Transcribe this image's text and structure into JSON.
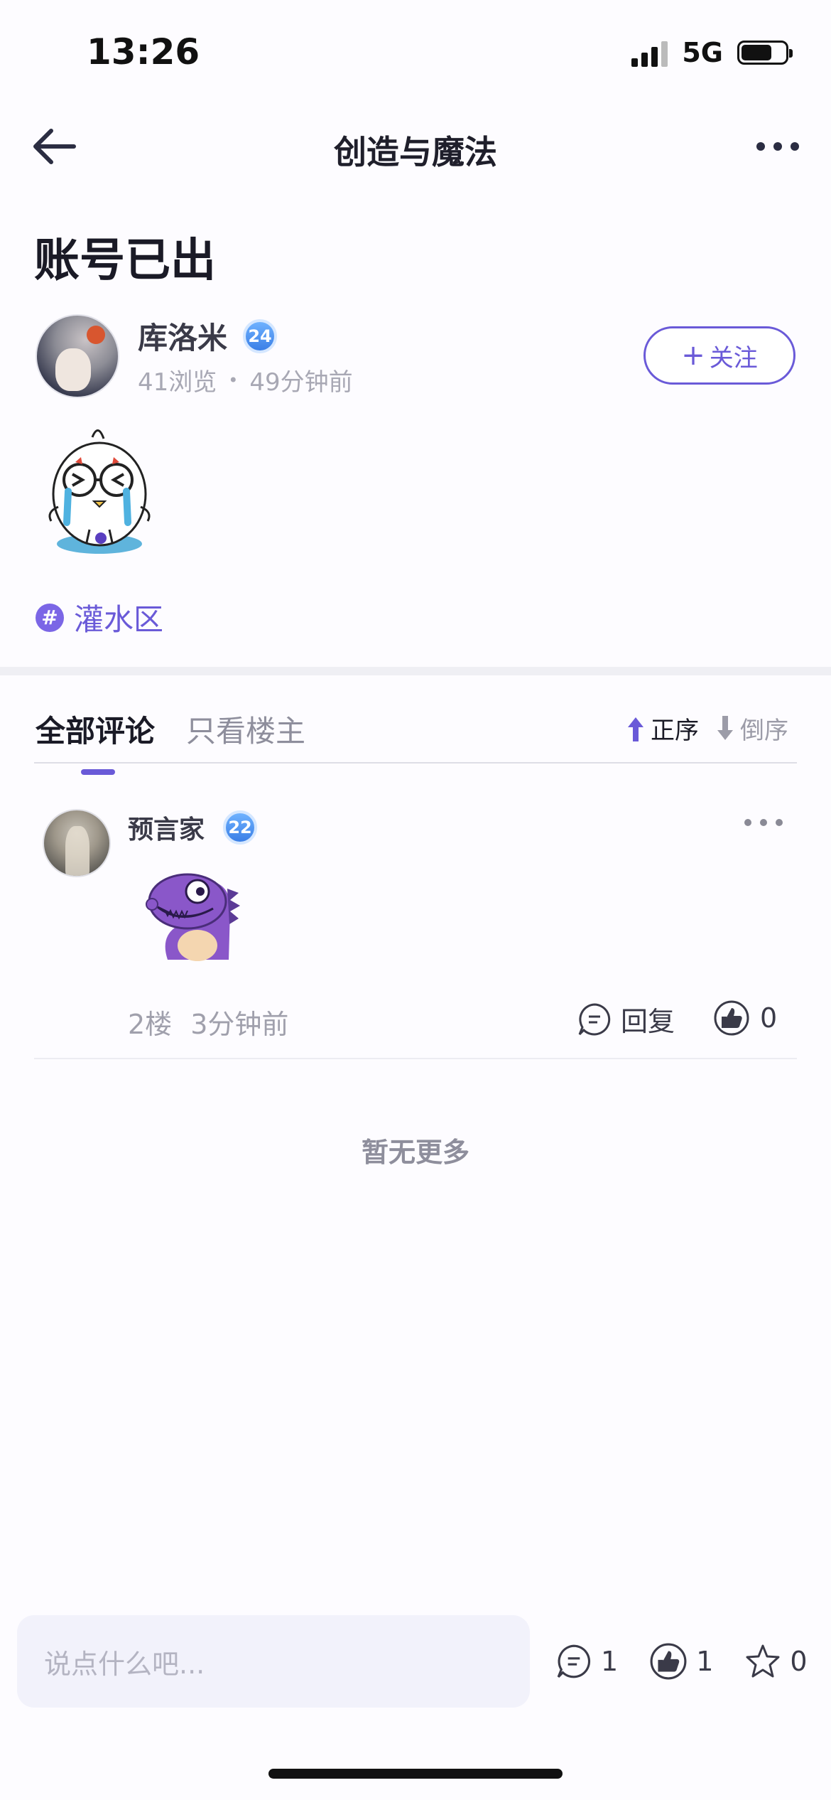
{
  "status_bar": {
    "time": "13:26",
    "network": "5G"
  },
  "nav": {
    "title": "创造与魔法",
    "back_icon": "arrow-left-icon",
    "more_icon": "more-horizontal-icon"
  },
  "post": {
    "title": "账号已出",
    "author": {
      "name": "库洛米",
      "level": "24",
      "views": "41浏览",
      "time": "49分钟前"
    },
    "follow_label": "关注",
    "tag": {
      "symbol": "#",
      "label": "灌水区"
    }
  },
  "tabs": [
    {
      "label": "全部评论",
      "active": true
    },
    {
      "label": "只看楼主",
      "active": false
    }
  ],
  "sort": {
    "asc_label": "正序",
    "desc_label": "倒序",
    "active": "asc"
  },
  "comments": [
    {
      "name": "预言家",
      "level": "22",
      "floor": "2楼",
      "time": "3分钟前",
      "reply_label": "回复",
      "likes": "0"
    }
  ],
  "no_more_text": "暂无更多",
  "bottom_bar": {
    "input_placeholder": "说点什么吧...",
    "comments": "1",
    "likes": "1",
    "favorites": "0"
  },
  "colors": {
    "accent": "#6a5ad8",
    "muted": "#a8a8b4",
    "background": "#fdfcff"
  }
}
